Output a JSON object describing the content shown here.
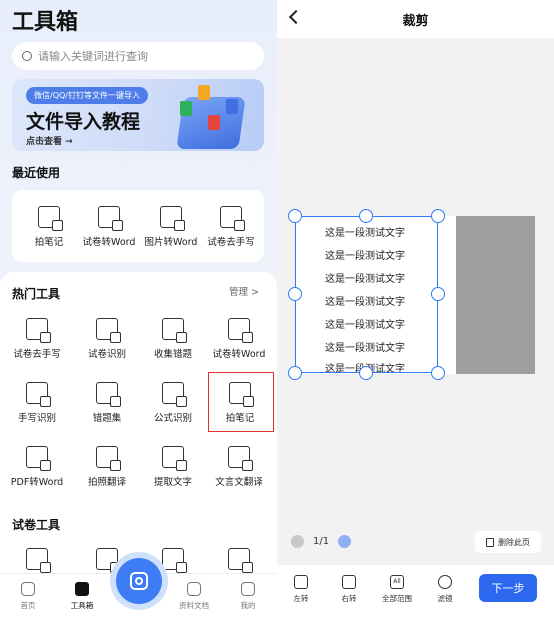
{
  "left": {
    "title": "工具箱",
    "search": {
      "placeholder": "请输入关键词进行查询"
    },
    "banner": {
      "pill": "微信/QQ/钉钉等文件一键导入",
      "title": "文件导入教程",
      "link": "点击查看 →"
    },
    "recent": {
      "heading": "最近使用",
      "items": [
        "拍笔记",
        "试卷转Word",
        "图片转Word",
        "试卷去手写"
      ]
    },
    "hot": {
      "heading": "热门工具",
      "manage": "管理 >",
      "rows": [
        [
          "试卷去手写",
          "试卷识别",
          "收集错题",
          "试卷转Word"
        ],
        [
          "手写识别",
          "错题集",
          "公式识别",
          "拍笔记"
        ],
        [
          "PDF转Word",
          "拍照翻译",
          "提取文字",
          "文言文翻译"
        ]
      ]
    },
    "exam": {
      "heading": "试卷工具"
    },
    "tabs": [
      "首页",
      "工具箱",
      "资料文档",
      "我的"
    ]
  },
  "right": {
    "title": "裁剪",
    "lines": [
      "这是一段测试文字",
      "这是一段测试文字",
      "这是一段测试文字",
      "这是一段测试文字",
      "这是一段测试文字",
      "这是一段测试文字",
      "这是一段测试文字"
    ],
    "page": "1/1",
    "delete": "删除此页",
    "actions": [
      "左转",
      "右转",
      "全部范围",
      "滤镜"
    ],
    "action_glyph": "All",
    "next": "下一步"
  },
  "colors": {
    "accent": "#2d69f0",
    "highlight": "#e0322c",
    "crop": "#2f7bf5"
  }
}
